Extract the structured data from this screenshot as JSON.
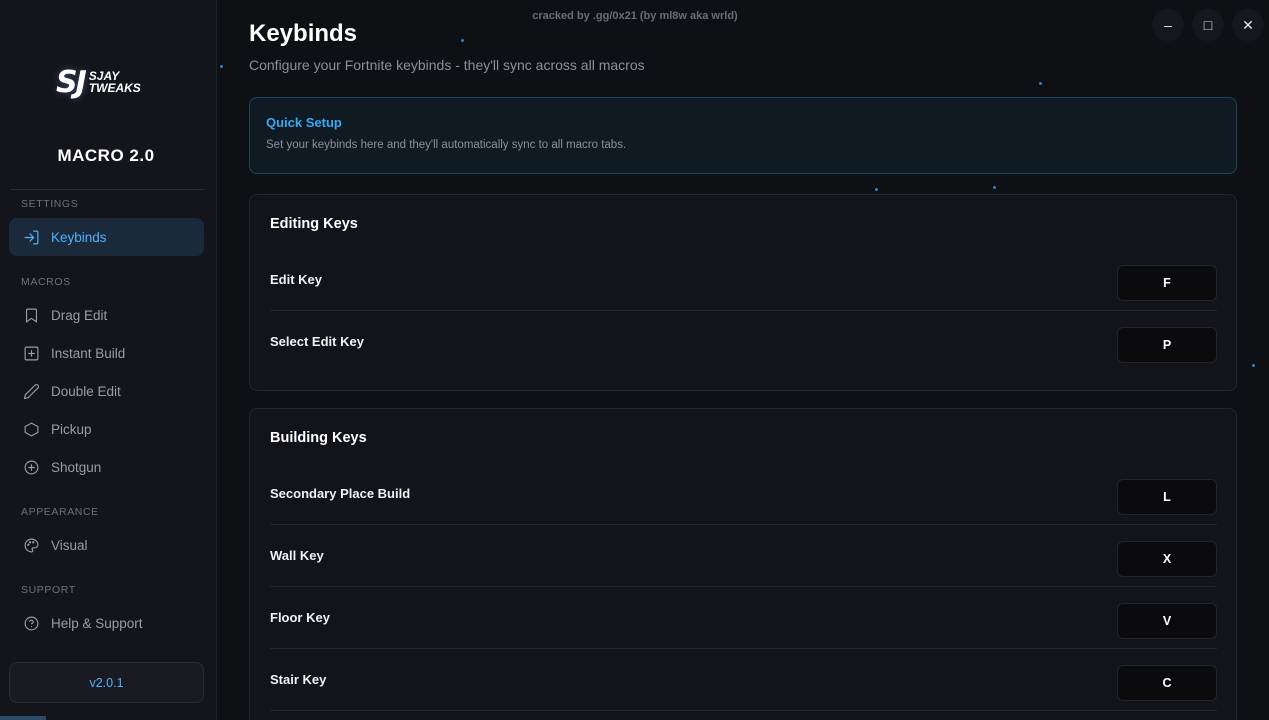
{
  "watermark": "cracked by .gg/0x21 (by ml8w aka wrld)",
  "brand": {
    "logo_mark": "SJ",
    "logo_line1": "SJAY",
    "logo_line2": "TWEAKS",
    "app_title": "MACRO 2.0"
  },
  "sidebar": {
    "sections": {
      "settings": "SETTINGS",
      "macros": "MACROS",
      "appearance": "APPEARANCE",
      "support": "SUPPORT"
    },
    "items": [
      {
        "label": "Keybinds",
        "icon": "login-arrow-icon",
        "active": true
      },
      {
        "label": "Drag Edit",
        "icon": "bookmark-icon"
      },
      {
        "label": "Instant Build",
        "icon": "plus-square-icon"
      },
      {
        "label": "Double Edit",
        "icon": "pencil-icon"
      },
      {
        "label": "Pickup",
        "icon": "hexagon-icon"
      },
      {
        "label": "Shotgun",
        "icon": "plus-circle-icon"
      },
      {
        "label": "Visual",
        "icon": "palette-icon"
      },
      {
        "label": "Help & Support",
        "icon": "help-circle-icon"
      }
    ],
    "version": "v2.0.1"
  },
  "window_controls": {
    "minimize": "–",
    "maximize": "□",
    "close": "✕"
  },
  "page": {
    "title": "Keybinds",
    "subtitle": "Configure your Fortnite keybinds - they'll sync across all macros"
  },
  "quick_setup": {
    "title": "Quick Setup",
    "text": "Set your keybinds here and they'll automatically sync to all macro tabs."
  },
  "editing_keys": {
    "title": "Editing Keys",
    "rows": [
      {
        "label": "Edit Key",
        "key": "F"
      },
      {
        "label": "Select Edit Key",
        "key": "P"
      }
    ]
  },
  "building_keys": {
    "title": "Building Keys",
    "rows": [
      {
        "label": "Secondary Place Build",
        "key": "L"
      },
      {
        "label": "Wall Key",
        "key": "X"
      },
      {
        "label": "Floor Key",
        "key": "V"
      },
      {
        "label": "Stair Key",
        "key": "C"
      }
    ]
  },
  "colors": {
    "accent": "#4fb4ff",
    "active_bg": "#1b2a3b",
    "background": "#0f1014",
    "sidebar": "#14151b"
  }
}
